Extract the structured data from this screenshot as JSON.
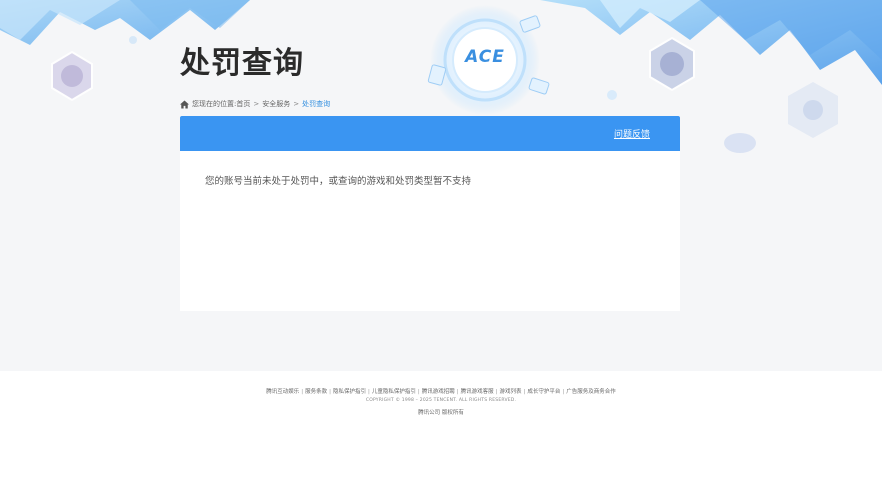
{
  "page": {
    "title": "处罚查询"
  },
  "breadcrumb": {
    "prefix": "您现在的位置:",
    "items": [
      "首页",
      "安全服务"
    ],
    "current": "处罚查询",
    "separator": ">"
  },
  "panel": {
    "feedback_label": "问题反馈",
    "message": "您的账号当前未处于处罚中，或查询的游戏和处罚类型暂不支持"
  },
  "footer": {
    "links": [
      "腾讯互动娱乐",
      "服务条款",
      "隐私保护指引",
      "儿童隐私保护指引",
      "腾讯游戏招聘",
      "腾讯游戏客服",
      "游戏列表",
      "成长守护平台",
      "广告服务及商务合作"
    ],
    "link_separator": "|",
    "copyright": "COPYRIGHT © 1998 – 2025 TENCENT. ALL RIGHTS RESERVED.",
    "company": "腾讯公司 版权所有"
  },
  "logo": {
    "text": "ACE"
  },
  "colors": {
    "accent": "#3a95f2",
    "title": "#2b2b2b",
    "breadcrumb_current": "#2f8ddf",
    "background": "#f5f6f8"
  }
}
